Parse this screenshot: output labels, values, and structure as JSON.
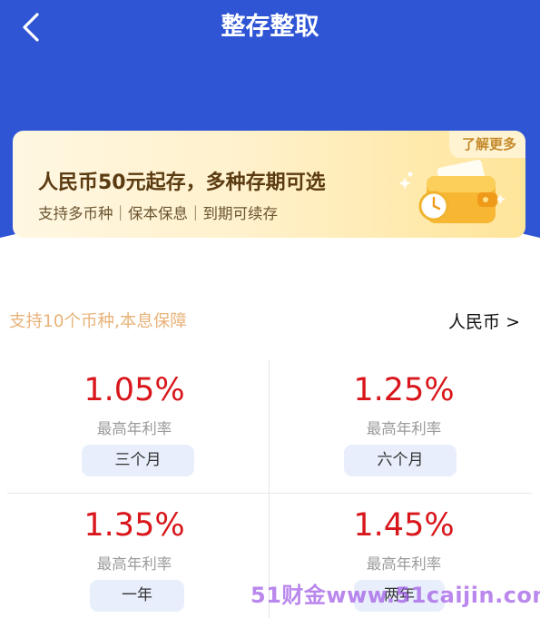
{
  "header": {
    "title": "整存整取",
    "back_icon": "chevron-left-icon",
    "background_color": "#2f55d4"
  },
  "banner": {
    "title": "人民币50元起存，多种存期可选",
    "subtitle": "支持多币种｜保本保息｜到期可续存",
    "more_label": "了解更多",
    "icon": "wallet-clock-icon"
  },
  "section": {
    "note": "支持10个币种,本息保障",
    "currency_label": "人民币 >"
  },
  "rates": [
    {
      "rate": "1.05%",
      "label": "最高年利率",
      "term": "三个月"
    },
    {
      "rate": "1.25%",
      "label": "最高年利率",
      "term": "六个月"
    },
    {
      "rate": "1.35%",
      "label": "最高年利率",
      "term": "一年"
    },
    {
      "rate": "1.45%",
      "label": "最高年利率",
      "term": "两年"
    }
  ],
  "watermark": "51财金www.51caijin.com",
  "colors": {
    "accent_blue": "#2f55d4",
    "rate_red": "#d8161b",
    "note_orange": "#e8b37a",
    "pill_bg": "#e8eefb"
  }
}
